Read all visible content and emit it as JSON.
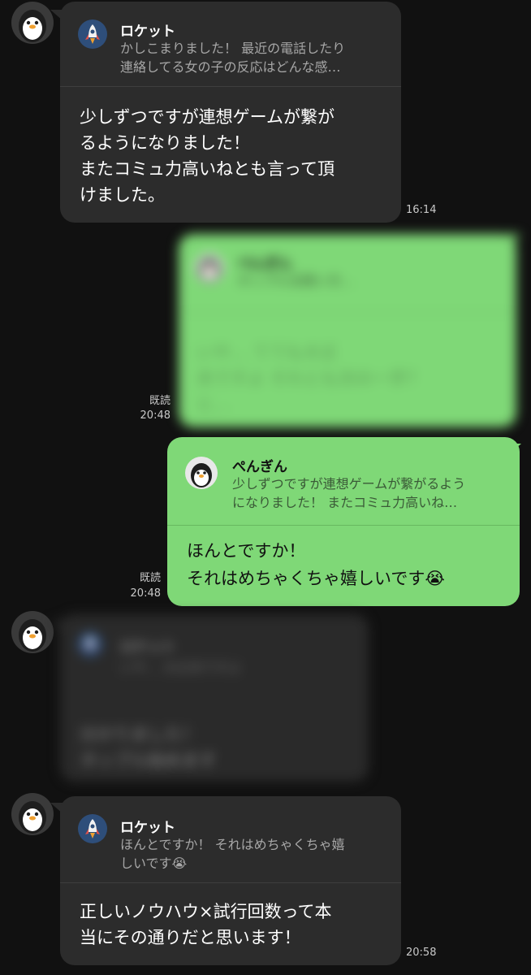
{
  "messages": [
    {
      "quote_name": "ロケット",
      "quote_text_1": "かしこまりました！ 最近の電話したり",
      "quote_text_2": "連絡してる女の子の反応はどんな感…",
      "text_1": "少しずつですが連想ゲームが繋が",
      "text_2": "るようになりました！",
      "text_3": "またコミュ力高いねとも言って頂",
      "text_4": "けました。",
      "time": "16:14"
    },
    {
      "quote_name": "ぺんぎん",
      "quote_text_1": "タップル法使い方…",
      "text_1": "いや… てても大丈",
      "text_2": "夫ですよ それとも次の一手？",
      "text_3": "と…",
      "read": "既読",
      "time": "20:48"
    },
    {
      "quote_name": "ぺんぎん",
      "quote_text_1": "少しずつですが連想ゲームが繋がるよう",
      "quote_text_2": "になりました！ またコミュ力高いね…",
      "text_1": "ほんとですか！",
      "text_2": "それはめちゃくちゃ嬉しいです",
      "emoji": "😭",
      "read": "既読",
      "time": "20:48"
    },
    {
      "quote_name": "ロケット",
      "quote_text_1": "いや… 大丈夫ですよ",
      "text_1": "分かりました！",
      "text_2": "タップル始めます"
    },
    {
      "quote_name": "ロケット",
      "quote_text_1": "ほんとですか！ それはめちゃくちゃ嬉",
      "quote_text_2": "しいです",
      "quote_emoji": "😭",
      "text_1": "正しいノウハウ×試行回数って本",
      "text_2": "当にその通りだと思います！",
      "time": "20:58"
    }
  ],
  "colors": {
    "background": "#111111",
    "incoming_bubble": "#2c2c2c",
    "outgoing_bubble": "#7fd877"
  },
  "icons": {
    "sender_avatar": "penguin-icon",
    "quote_avatar_self": "rocket-icon",
    "quote_avatar_other": "penguin-icon"
  }
}
